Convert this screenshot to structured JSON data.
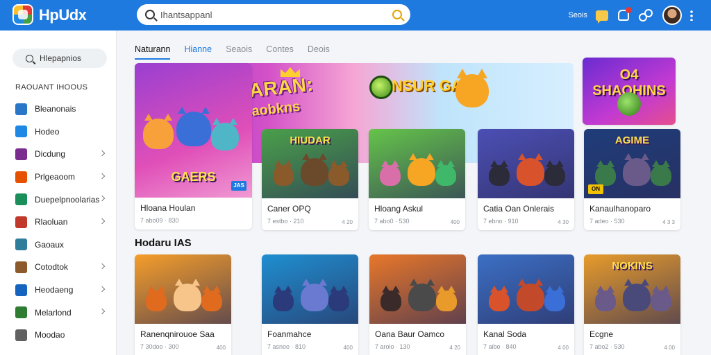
{
  "app": {
    "name": "HpUdx"
  },
  "top_search": {
    "placeholder": "Ihantsappanl"
  },
  "topbar": {
    "link_label": "Seois",
    "icons": [
      "search-icon",
      "chat-icon",
      "bell-icon",
      "friends-icon",
      "avatar",
      "more-icon"
    ]
  },
  "sidebar": {
    "search_label": "Hlepapnios",
    "heading": "RAOUANT IHOOUS",
    "items": [
      {
        "label": "Bleanonais",
        "icon_color": "#2a76c9",
        "chevron": false
      },
      {
        "label": "Hodeo",
        "icon_color": "#1e88e5",
        "chevron": false
      },
      {
        "label": "Dicdung",
        "icon_color": "#7b2c8f",
        "chevron": true
      },
      {
        "label": "Prlgeaoom",
        "icon_color": "#e65100",
        "chevron": true
      },
      {
        "label": "Duepelpnoolarias",
        "icon_color": "#1b8f5a",
        "chevron": true
      },
      {
        "label": "Rlaoluan",
        "icon_color": "#c0392b",
        "chevron": true
      },
      {
        "label": "Gaoaux",
        "icon_color": "#2e7d9a",
        "chevron": false
      },
      {
        "label": "Cotodtok",
        "icon_color": "#8d5a2b",
        "chevron": true
      },
      {
        "label": "Heodaeng",
        "icon_color": "#1565c0",
        "chevron": true
      },
      {
        "label": "Melarlond",
        "icon_color": "#2e7d32",
        "chevron": true
      },
      {
        "label": "Moodao",
        "icon_color": "#616161",
        "chevron": false
      }
    ]
  },
  "tabs": [
    {
      "label": "Naturann",
      "state": "active"
    },
    {
      "label": "Hianne",
      "state": "highlight"
    },
    {
      "label": "Seaois",
      "state": "normal"
    },
    {
      "label": "Contes",
      "state": "normal"
    },
    {
      "label": "Deois",
      "state": "normal"
    }
  ],
  "hero": {
    "banner_title": "HIBARAN:",
    "banner_sub": "Saobkns",
    "game_title": "NSUR GAME",
    "card": {
      "label": "GAERS",
      "title": "Hloana Houlan",
      "meta": "7 abo09 · 830",
      "badge": "JAS"
    }
  },
  "featured_cards": [
    {
      "label": "HIUDAR",
      "title": "Caner OPQ",
      "meta": "7 estbo · 210",
      "count": "4 20",
      "bg": "#4aa04a"
    },
    {
      "label": "",
      "title": "Hloang Askul",
      "meta": "7 abo0 · 530",
      "count": "400",
      "bg": "#65c44a"
    },
    {
      "label": "",
      "title": "Catia Oan Onlerais",
      "meta": "7 ebno · 910",
      "count": "4 30",
      "bg": "#4c4fb4"
    },
    {
      "label": "AGIME",
      "title": "Kanaulhanoparo",
      "meta": "7 adeo · 530",
      "count": "4 3 3",
      "bg": "#1f3d7a",
      "badge": "ON"
    }
  ],
  "side_promos": [
    {
      "label": "O4 SHAOHINS"
    }
  ],
  "section": {
    "title": "Hodaru IAS"
  },
  "bottom_cards": [
    {
      "title": "Ranenqnirouoe Saa",
      "meta": "7 30doo · 300",
      "count": "400",
      "bg": "#f59e2a"
    },
    {
      "title": "Foanmahce",
      "meta": "7 asnoo · 810",
      "count": "400",
      "bg": "#1f8fd0"
    },
    {
      "title": "Oana Baur Oamco",
      "meta": "7 arolo · 130",
      "count": "4 20",
      "bg": "#e8772a"
    },
    {
      "title": "Kanal Soda",
      "meta": "7 aibo · 840",
      "count": "4 00",
      "bg": "#3b6fc4"
    },
    {
      "title": "Ecgne",
      "meta": "7 abo2 · 530",
      "count": "4 00",
      "bg": "#e79b2b",
      "label": "NOKINS"
    }
  ]
}
